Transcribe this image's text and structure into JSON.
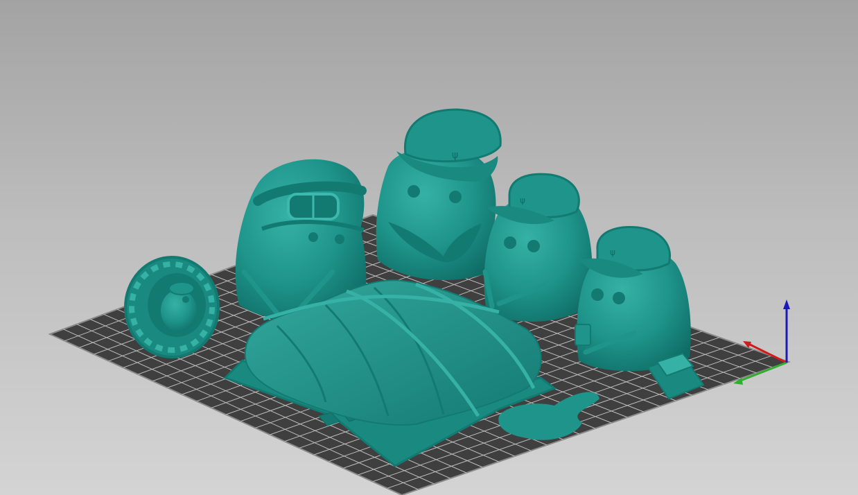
{
  "viewport": {
    "background_top": "#a3a3a3",
    "background_bottom": "#d4d4d4"
  },
  "bed": {
    "color": "#3f3f3f",
    "grid_color": "#bdbdbd",
    "border_color": "#8a8a8a"
  },
  "model": {
    "color": "#1e948a",
    "shade_color": "#137a72",
    "highlight_color": "#36b1a6",
    "objects": [
      "figure-goggles",
      "figure-cap-large",
      "figure-cap-middle",
      "figure-cap-right",
      "tire-figure",
      "pallet-with-sandbags",
      "puddle",
      "crate-stack"
    ]
  },
  "axes": {
    "x_color": "#d11a1a",
    "y_color": "#2fae2f",
    "z_color": "#1a1ab8"
  }
}
